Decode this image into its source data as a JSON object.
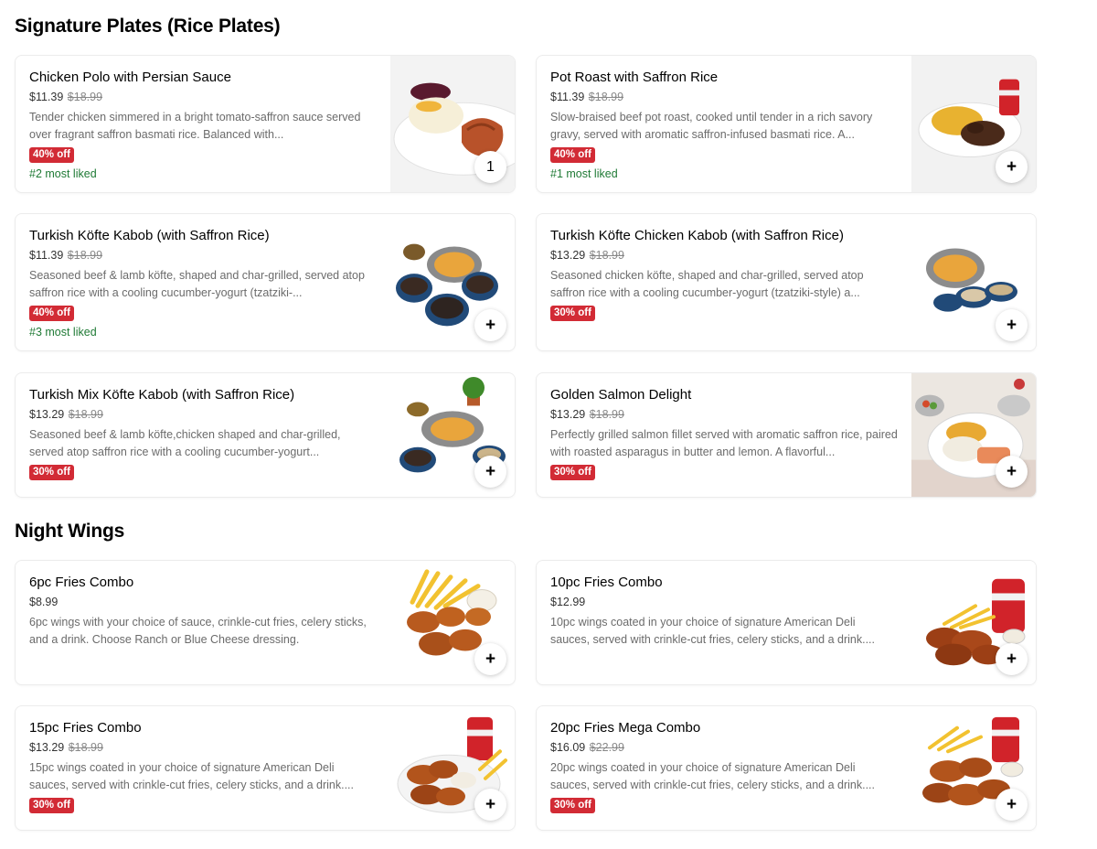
{
  "sections": [
    {
      "title": "Signature Plates (Rice Plates)",
      "items": [
        {
          "name": "Chicken Polo with Persian Sauce",
          "price": "$11.39",
          "original_price": "$18.99",
          "description": "Tender chicken simmered in a bright tomato-saffron sauce served over fragrant saffron basmati rice. Balanced with...",
          "discount": "40% off",
          "rank": "#2 most liked",
          "button": "1",
          "image": "chicken-polo-plate"
        },
        {
          "name": "Pot Roast with Saffron Rice",
          "price": "$11.39",
          "original_price": "$18.99",
          "description": "Slow-braised beef pot roast, cooked until tender in a rich savory gravy, served with aromatic saffron-infused basmati rice. A...",
          "discount": "40% off",
          "rank": "#1 most liked",
          "button": "+",
          "image": "pot-roast-plate"
        },
        {
          "name": "Turkish Köfte Kabob (with Saffron Rice)",
          "price": "$11.39",
          "original_price": "$18.99",
          "description": "Seasoned beef & lamb köfte, shaped and char-grilled, served atop saffron rice with a cooling cucumber-yogurt (tzatziki-...",
          "discount": "40% off",
          "rank": "#3 most liked",
          "button": "+",
          "image": "kofte-kabob-bowls"
        },
        {
          "name": "Turkish Köfte Chicken Kabob (with Saffron Rice)",
          "price": "$13.29",
          "original_price": "$18.99",
          "description": "Seasoned chicken köfte, shaped and char-grilled, served atop saffron rice with a cooling cucumber-yogurt (tzatziki-style) a...",
          "discount": "30% off",
          "rank": "",
          "button": "+",
          "image": "chicken-kofte-bowls"
        },
        {
          "name": "Turkish Mix Köfte Kabob (with Saffron Rice)",
          "price": "$13.29",
          "original_price": "$18.99",
          "description": "Seasoned beef & lamb köfte,chicken shaped and char-grilled, served atop saffron rice with a cooling cucumber-yogurt...",
          "discount": "30% off",
          "rank": "",
          "button": "+",
          "image": "mix-kofte-bowls"
        },
        {
          "name": "Golden Salmon Delight",
          "price": "$13.29",
          "original_price": "$18.99",
          "description": "Perfectly grilled salmon fillet served with aromatic saffron rice, paired with roasted asparagus in butter and lemon. A flavorful...",
          "discount": "30% off",
          "rank": "",
          "button": "+",
          "image": "salmon-plate"
        }
      ]
    },
    {
      "title": "Night Wings",
      "items": [
        {
          "name": "6pc Fries Combo",
          "price": "$8.99",
          "original_price": "",
          "description": "6pc wings with your choice of sauce, crinkle-cut fries, celery sticks, and a drink. Choose Ranch or Blue Cheese dressing.",
          "discount": "",
          "rank": "",
          "button": "+",
          "image": "wings-fries"
        },
        {
          "name": "10pc Fries Combo",
          "price": "$12.99",
          "original_price": "",
          "description": "10pc wings coated in your choice of signature American Deli sauces, served with crinkle-cut fries, celery sticks, and a drink....",
          "discount": "",
          "rank": "",
          "button": "+",
          "image": "wings-fries-cola"
        },
        {
          "name": "15pc Fries Combo",
          "price": "$13.29",
          "original_price": "$18.99",
          "description": "15pc wings coated in your choice of signature American Deli sauces, served with crinkle-cut fries, celery sticks, and a drink....",
          "discount": "30% off",
          "rank": "",
          "button": "+",
          "image": "wings-platter-cola"
        },
        {
          "name": "20pc Fries Mega Combo",
          "price": "$16.09",
          "original_price": "$22.99",
          "description": "20pc wings coated in your choice of signature American Deli sauces, served with crinkle-cut fries, celery sticks, and a drink....",
          "discount": "30% off",
          "rank": "",
          "button": "+",
          "image": "wings-mega-cola"
        }
      ]
    }
  ],
  "colors": {
    "discount_badge": "#d22b35",
    "most_liked": "#1f7a35",
    "description": "#6b6b6b",
    "original_price": "#888888"
  }
}
